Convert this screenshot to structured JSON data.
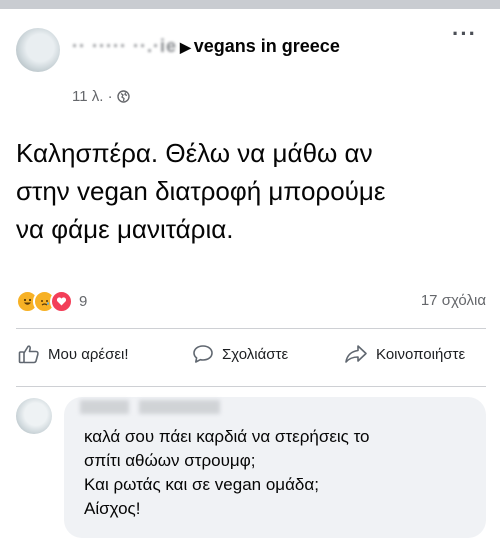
{
  "post": {
    "author_name": "vegans in greece",
    "author_blurred_prefix": "·· ····· ··.·ie",
    "timestamp": "11 λ. ·",
    "audience_icon": "globe-icon",
    "text": "Καλησπέρα. Θέλω να μάθω αν\nστην vegan διατροφή μπορούμε\nνα φάμε μανιτάρια.",
    "more_label": "···"
  },
  "stats": {
    "reactions": [
      "haha",
      "sad",
      "love"
    ],
    "reaction_count": "9",
    "comments_count": "17 σχόλια"
  },
  "actions": {
    "like_label": "Μου αρέσει!",
    "comment_label": "Σχολιάστε",
    "share_label": "Κοινοποιήστε"
  },
  "comment": {
    "lines": [
      "καλά σου πάει καρδιά να στερήσεις το",
      "σπίτι αθώων στρουμφ;",
      "Και ρωτάς και σε vegan ομάδα;",
      "Αίσχος!"
    ]
  },
  "colors": {
    "text": "#050505",
    "secondary_text": "#65676b",
    "bubble": "#f0f2f5",
    "love_red": "#f33e58",
    "haha_yellow": "#f7b125"
  }
}
